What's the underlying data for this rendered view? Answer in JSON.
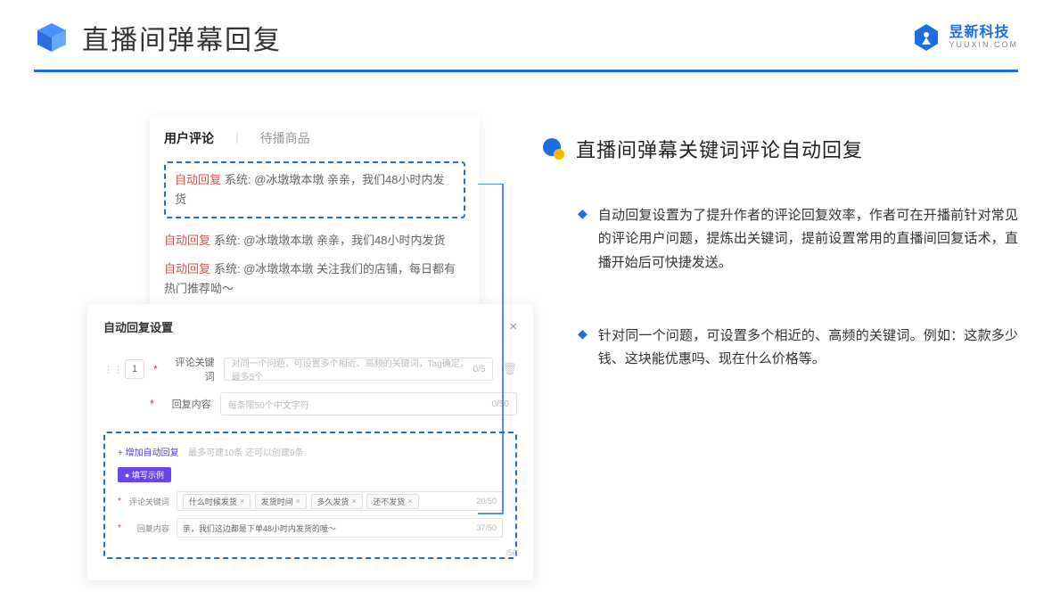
{
  "header": {
    "title": "直播间弹幕回复",
    "brand_cn": "昱新科技",
    "brand_en": "YUUXIN.COM"
  },
  "comments_card": {
    "tab_active": "用户评论",
    "tab_inactive": "待播商品",
    "items": [
      {
        "tag": "自动回复",
        "text": "系统: @冰墩墩本墩 亲亲，我们48小时内发货"
      },
      {
        "tag": "自动回复",
        "text": "系统: @冰墩墩本墩 亲亲，我们48小时内发货"
      },
      {
        "tag": "自动回复",
        "text": "系统: @冰墩墩本墩 关注我们的店铺，每日都有热门推荐呦～"
      }
    ]
  },
  "settings": {
    "title": "自动回复设置",
    "order": "1",
    "keyword_label": "评论关键词",
    "keyword_placeholder": "对同一个问题，可设置多个相近、高频的关键词，Tag确定，最多5个",
    "keyword_counter": "0/5",
    "content_label": "回复内容",
    "content_placeholder": "每条限50个中文字符",
    "content_counter": "0/50",
    "add_link": "+ 增加自动回复",
    "add_hint": "最多可建10条 还可以创建9条",
    "example_pill": "● 填写示例",
    "example": {
      "keyword_label": "评论关键词",
      "content_label": "回复内容",
      "tags": [
        "什么时候发货",
        "发货时间",
        "多久发货",
        "还不发货"
      ],
      "tag_counter": "20/50",
      "content_value": "亲，我们这边都是下单48小时内发货的哦～",
      "content_counter": "37/50"
    },
    "stray_counter": "/50"
  },
  "right": {
    "section_title": "直播间弹幕关键词评论自动回复",
    "bullets": [
      "自动回复设置为了提升作者的评论回复效率，作者可在开播前针对常见的评论用户问题，提炼出关键词，提前设置常用的直播间回复话术，直播开始后可快捷发送。",
      "针对同一个问题，可设置多个相近的、高频的关键词。例如：这款多少钱、这块能优惠吗、现在什么价格等。"
    ]
  }
}
